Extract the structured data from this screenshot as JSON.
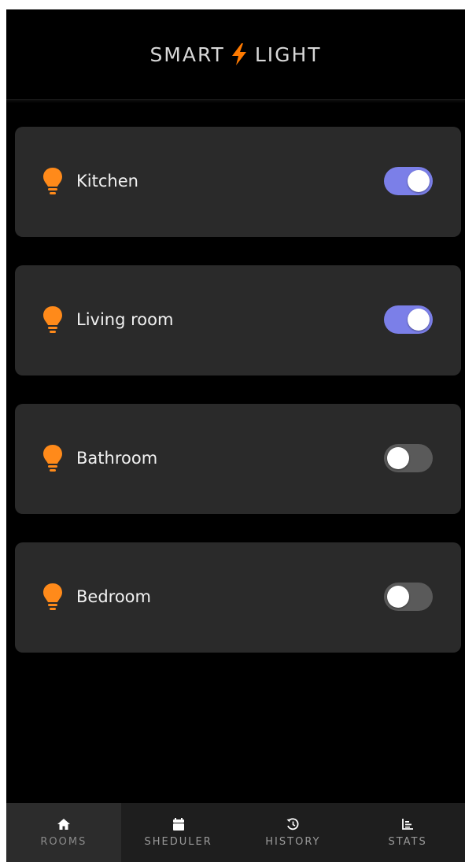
{
  "header": {
    "title_left": "SMART",
    "title_right": "LIGHT",
    "bolt_color": "#ff7a00"
  },
  "rooms": [
    {
      "name": "Kitchen",
      "on": true
    },
    {
      "name": "Living room",
      "on": true
    },
    {
      "name": "Bathroom",
      "on": false
    },
    {
      "name": "Bedroom",
      "on": false
    }
  ],
  "bulb_color": "#ff8a1a",
  "toggle_on_color": "#7b7fe8",
  "nav": {
    "items": [
      {
        "label": "ROOMS",
        "icon": "home-icon",
        "active": true
      },
      {
        "label": "SHEDULER",
        "icon": "calendar-icon",
        "active": false
      },
      {
        "label": "HISTORY",
        "icon": "history-icon",
        "active": false
      },
      {
        "label": "STATS",
        "icon": "stats-icon",
        "active": false
      }
    ]
  }
}
